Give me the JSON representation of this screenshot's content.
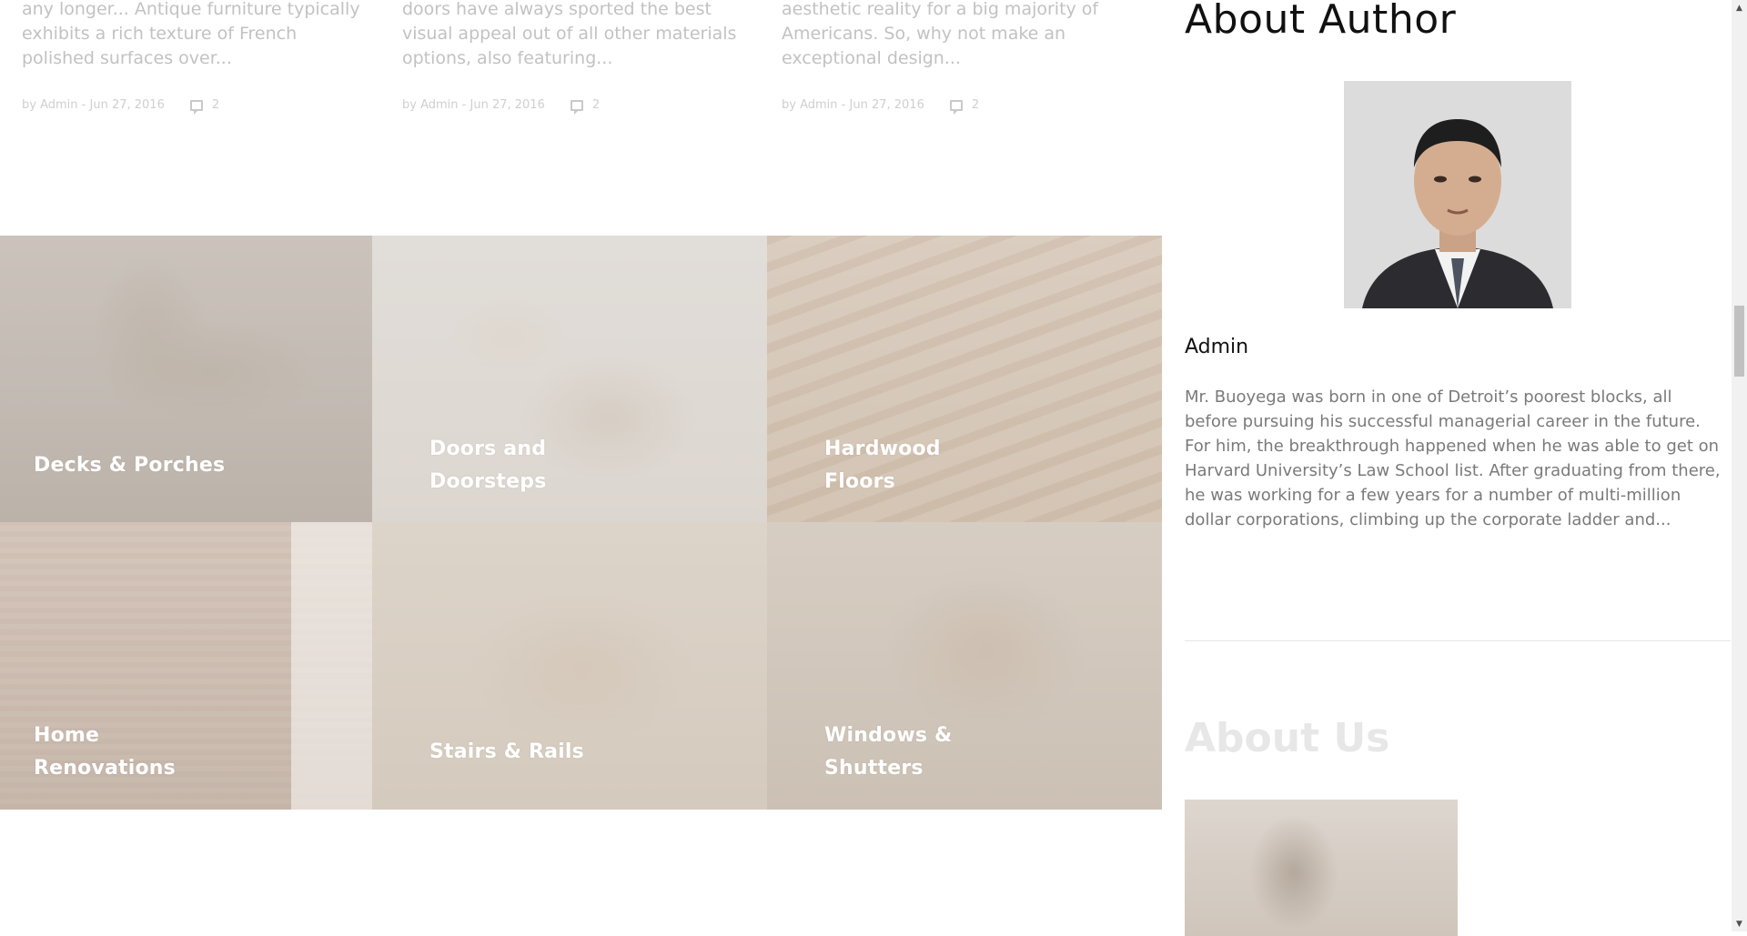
{
  "posts": [
    {
      "excerpt": "any longer... Antique furniture typically exhibits a rich texture of French polished surfaces over...",
      "by": "by",
      "author": "Admin",
      "separator": "-",
      "date": "Jun 27, 2016",
      "comments": "2"
    },
    {
      "excerpt": "doors have always sported the best visual appeal out of all other materials options, also featuring...",
      "by": "by",
      "author": "Admin",
      "separator": "-",
      "date": "Jun 27, 2016",
      "comments": "2"
    },
    {
      "excerpt": "aesthetic reality for a big majority of Americans. So, why not make an exceptional design...",
      "by": "by",
      "author": "Admin",
      "separator": "-",
      "date": "Jun 27, 2016",
      "comments": "2"
    }
  ],
  "services": [
    {
      "line1": "Decks & Porches",
      "line2": ""
    },
    {
      "line1": "Doors and",
      "line2": "Doorsteps"
    },
    {
      "line1": "Hardwood",
      "line2": "Floors"
    },
    {
      "line1": "Home",
      "line2": "Renovations"
    },
    {
      "line1": "Stairs & Rails",
      "line2": ""
    },
    {
      "line1": "Windows &",
      "line2": "Shutters"
    }
  ],
  "sidebar": {
    "about_author_title": "About Author",
    "author_name": "Admin",
    "author_bio": "Mr. Buoyega was born in one of Detroit’s poorest blocks, all before pursuing his successful managerial career in the future. For him, the breakthrough happened when he was able to get on Harvard University’s Law School list. After graduating from there, he was working for a few years for a number of multi-million dollar corporations, climbing up the corporate ladder and...",
    "about_us_title": "About Us"
  },
  "scrollbar": {
    "up_icon": "scroll-up-arrow",
    "down_icon": "scroll-down-arrow",
    "position_fraction": 0.35
  }
}
